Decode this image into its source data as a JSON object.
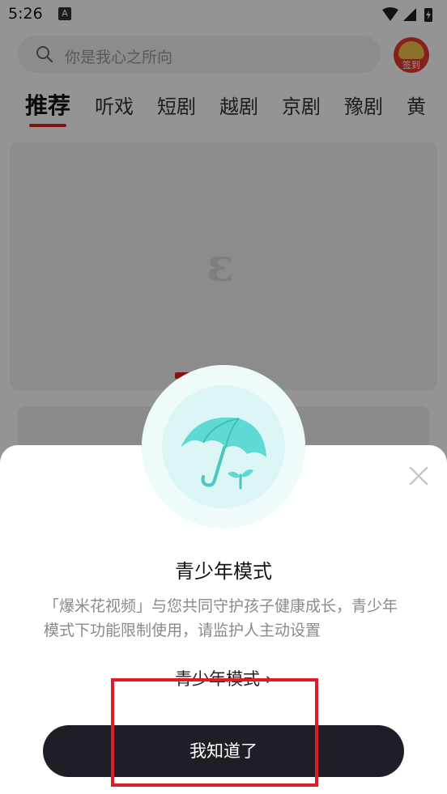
{
  "status_bar": {
    "time": "5:26",
    "badge": "A"
  },
  "search": {
    "placeholder": "你是我心之所向"
  },
  "sign_in": {
    "label": "签到"
  },
  "tabs": [
    "推荐",
    "听戏",
    "短剧",
    "越剧",
    "京剧",
    "豫剧",
    "黄"
  ],
  "modal": {
    "title": "青少年模式",
    "description": "「爆米花视频」与您共同守护孩子健康成长，青少年模式下功能限制使用，请监护人主动设置",
    "link_label": "青少年模式 ›",
    "confirm_label": "我知道了"
  },
  "colors": {
    "accent": "#e2231a",
    "button_bg": "#1f1d26",
    "highlight": "#e01b2a",
    "umbrella": "#5ed9d3"
  }
}
